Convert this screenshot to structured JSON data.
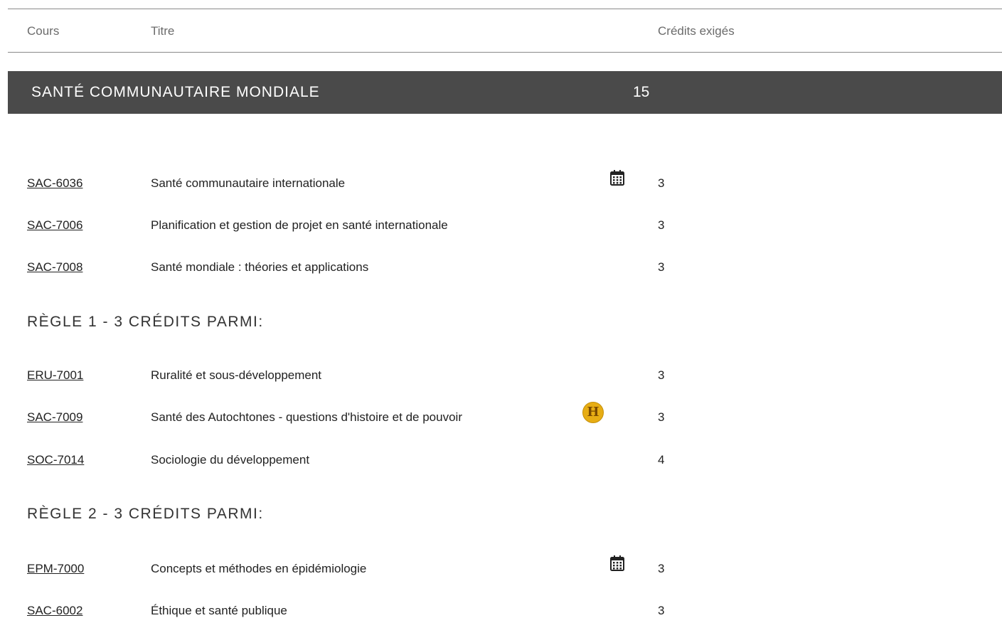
{
  "table_header": {
    "cours": "Cours",
    "titre": "Titre",
    "credits": "Crédits exigés"
  },
  "section": {
    "title": "SANTÉ COMMUNAUTAIRE MONDIALE",
    "credits": "15"
  },
  "courses_main": [
    {
      "code": "SAC-6036",
      "title": "Santé communautaire internationale",
      "credits": "3",
      "icon": "calendar-icon"
    },
    {
      "code": "SAC-7006",
      "title": "Planification et gestion de projet en santé internationale",
      "credits": "3",
      "icon": ""
    },
    {
      "code": "SAC-7008",
      "title": "Santé mondiale : théories et applications",
      "credits": "3",
      "icon": ""
    }
  ],
  "rule1": {
    "heading": "RÈGLE 1 - 3 CRÉDITS PARMI:",
    "courses": [
      {
        "code": "ERU-7001",
        "title": "Ruralité et sous-développement",
        "credits": "3",
        "icon": ""
      },
      {
        "code": "SAC-7009",
        "title": "Santé des Autochtones - questions d'histoire et de pouvoir",
        "credits": "3",
        "icon": "hybrid-h-icon",
        "icon_text": "H"
      },
      {
        "code": "SOC-7014",
        "title": "Sociologie du développement",
        "credits": "4",
        "icon": ""
      }
    ]
  },
  "rule2": {
    "heading": "RÈGLE 2 - 3 CRÉDITS PARMI:",
    "courses": [
      {
        "code": "EPM-7000",
        "title": "Concepts et méthodes en épidémiologie",
        "credits": "3",
        "icon": "calendar-icon"
      },
      {
        "code": "SAC-6002",
        "title": "Éthique et santé publique",
        "credits": "3",
        "icon": ""
      }
    ]
  },
  "colors": {
    "section_bar_bg": "#4a4a4a",
    "h_badge": "#e7ad14",
    "text": "#222222",
    "header_text": "#6b6b6b"
  }
}
